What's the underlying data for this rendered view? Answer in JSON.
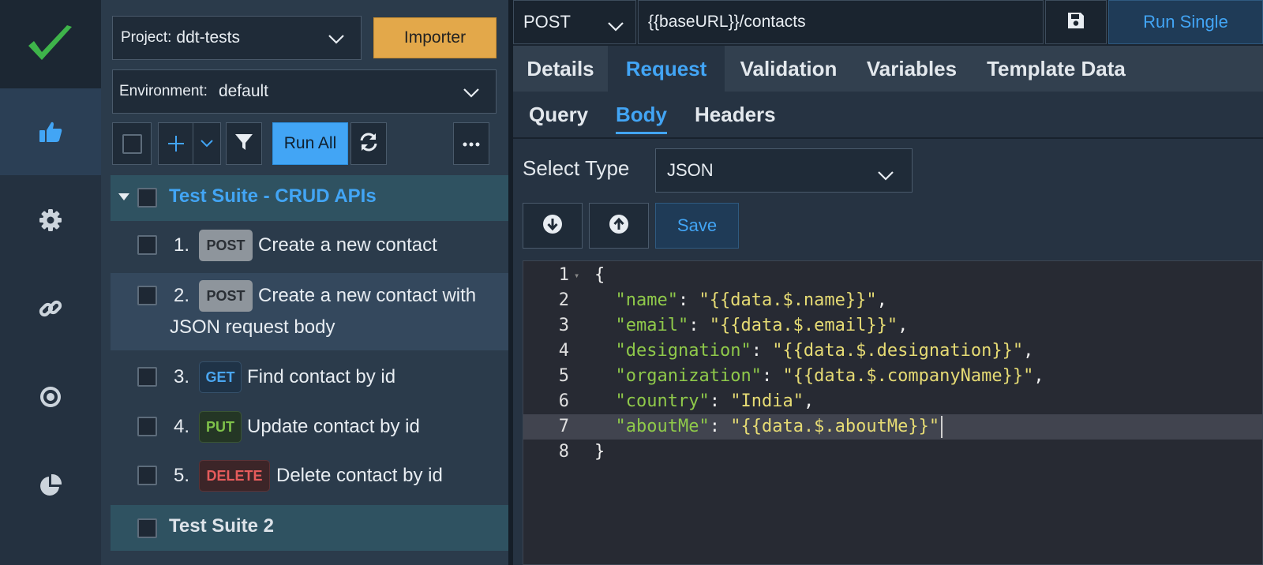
{
  "sidebar": {
    "logo_icon": "checkmark-logo",
    "items": [
      {
        "icon": "thumbs-up-icon",
        "active": true
      },
      {
        "icon": "gear-icon",
        "active": false
      },
      {
        "icon": "link-icon",
        "active": false
      },
      {
        "icon": "target-icon",
        "active": false
      },
      {
        "icon": "pie-chart-icon",
        "active": false
      }
    ]
  },
  "tree": {
    "project_label": "Project:",
    "project_value": "ddt-tests",
    "importer_label": "Importer",
    "environment_label": "Environment:",
    "environment_value": "default",
    "run_all_label": "Run All",
    "suites": [
      {
        "title": "Test Suite - CRUD APIs",
        "cases": [
          {
            "num": "1.",
            "method": "POST",
            "title": "Create a new contact"
          },
          {
            "num": "2.",
            "method": "POST",
            "title_line1": "Create a new contact with",
            "title_line2": "JSON request body"
          },
          {
            "num": "3.",
            "method": "GET",
            "title": "Find contact by id"
          },
          {
            "num": "4.",
            "method": "PUT",
            "title": "Update contact by id"
          },
          {
            "num": "5.",
            "method": "DELETE",
            "title": "Delete contact by id"
          }
        ]
      },
      {
        "title": "Test Suite 2"
      }
    ]
  },
  "request": {
    "method": "POST",
    "url": "{{baseURL}}/contacts",
    "run_single_label": "Run Single",
    "tabs": [
      "Details",
      "Request",
      "Validation",
      "Variables",
      "Template Data"
    ],
    "active_tab": "Request",
    "subtabs": [
      "Query",
      "Body",
      "Headers"
    ],
    "active_subtab": "Body",
    "select_type_label": "Select Type",
    "body_type": "JSON",
    "save_label": "Save",
    "body_lines": [
      {
        "n": "1",
        "text": "{"
      },
      {
        "n": "2",
        "key": "\"name\"",
        "value": "\"{{data.$.name}}\"",
        "trail": ","
      },
      {
        "n": "3",
        "key": "\"email\"",
        "value": "\"{{data.$.email}}\"",
        "trail": ","
      },
      {
        "n": "4",
        "key": "\"designation\"",
        "value": "\"{{data.$.designation}}\"",
        "trail": ","
      },
      {
        "n": "5",
        "key": "\"organization\"",
        "value": "\"{{data.$.companyName}}\"",
        "trail": ","
      },
      {
        "n": "6",
        "key": "\"country\"",
        "value": "\"India\"",
        "trail": ","
      },
      {
        "n": "7",
        "key": "\"aboutMe\"",
        "value": "\"{{data.$.aboutMe}}\"",
        "trail": ""
      },
      {
        "n": "8",
        "text": "}"
      }
    ],
    "active_line": "7"
  },
  "colors": {
    "accent": "#42a5f5",
    "importer": "#e3a84a",
    "suite_bg": "#2f5261",
    "json_key": "#8fc94a",
    "json_string": "#e6db74"
  }
}
